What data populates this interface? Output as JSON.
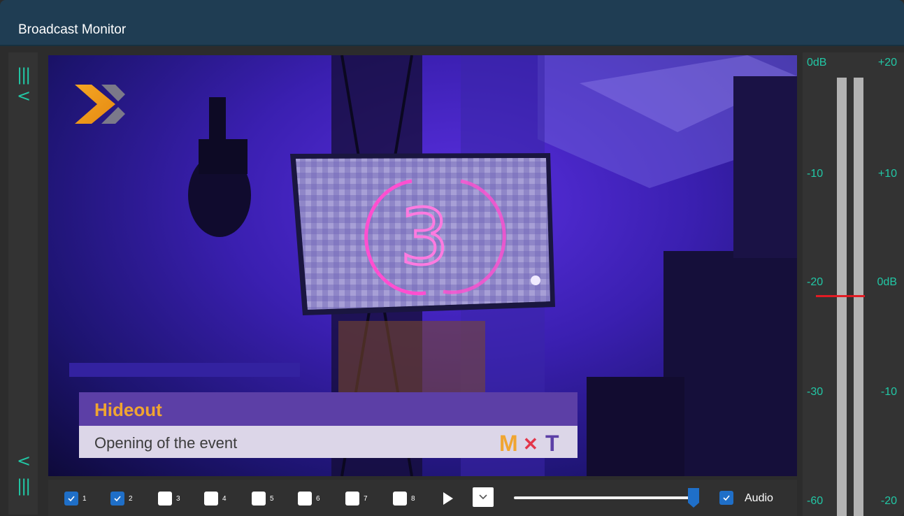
{
  "window": {
    "title": "Broadcast Monitor"
  },
  "side_panel": {
    "collapse_glyph": "<",
    "bars_glyph": "|||"
  },
  "video": {
    "lower_third": {
      "name": "Hideout",
      "subtitle": "Opening of the event",
      "logo_text": "MXT"
    },
    "screen_number": "3"
  },
  "controls": {
    "channels": [
      {
        "label": "1",
        "checked": true
      },
      {
        "label": "2",
        "checked": true
      },
      {
        "label": "3",
        "checked": false
      },
      {
        "label": "4",
        "checked": false
      },
      {
        "label": "5",
        "checked": false
      },
      {
        "label": "6",
        "checked": false
      },
      {
        "label": "7",
        "checked": false
      },
      {
        "label": "8",
        "checked": false
      }
    ],
    "volume_fraction": 0.98,
    "audio": {
      "label": "Audio",
      "checked": true
    }
  },
  "meter": {
    "left_scale": [
      "0dB",
      "-10",
      "-20",
      "-30",
      "-60"
    ],
    "right_scale": [
      "+20",
      "+10",
      "0dB",
      "-10",
      "-20"
    ],
    "peak_marker_color": "#e21b24"
  },
  "colors": {
    "accent": "#22c7a5",
    "titlebar": "#1f3d53",
    "checkbox_on": "#1f6fc8"
  }
}
